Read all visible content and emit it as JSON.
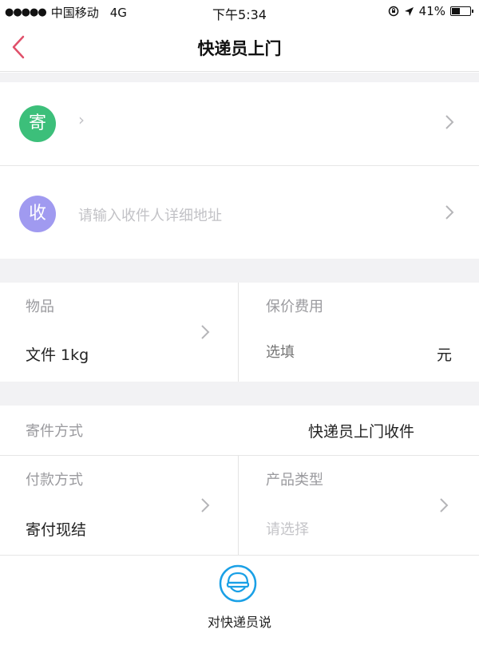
{
  "status_bar": {
    "signal": "●●●●●",
    "carrier": "中国移动",
    "network": "4G",
    "time": "下午5:34",
    "battery": "41%"
  },
  "nav": {
    "title": "快递员上门"
  },
  "sender": {
    "badge": "寄",
    "badge_color": "#3cbf7a",
    "address": "›"
  },
  "receiver": {
    "badge": "收",
    "badge_color": "#a09af0",
    "placeholder": "请输入收件人详细地址"
  },
  "item": {
    "label": "物品",
    "value": "文件 1kg"
  },
  "insurance": {
    "label": "保价费用",
    "placeholder": "选填",
    "unit": "元"
  },
  "send_method": {
    "label": "寄件方式",
    "value": "快递员上门收件"
  },
  "payment": {
    "label": "付款方式",
    "value": "寄付现结"
  },
  "product_type": {
    "label": "产品类型",
    "placeholder": "请选择"
  },
  "bottom": {
    "say_label": "对快递员说",
    "icon": "courier-helmet-icon",
    "accent": "#1aa0e6"
  }
}
